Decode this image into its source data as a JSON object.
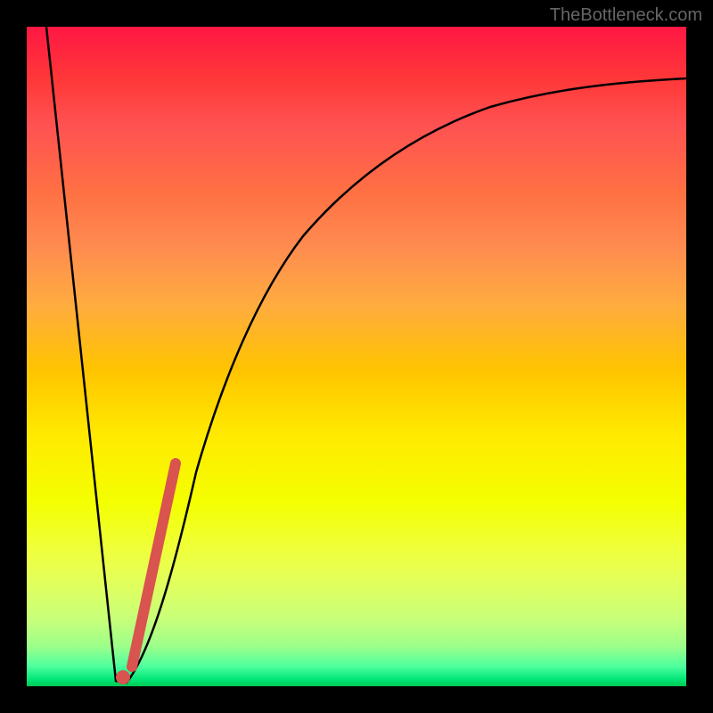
{
  "watermark": "TheBottleneck.com",
  "colors": {
    "overlay": "#d9534f",
    "curve": "#000000",
    "frame": "#000000"
  },
  "chart_data": {
    "type": "line",
    "title": "",
    "xlabel": "",
    "ylabel": "",
    "xlim": [
      0,
      100
    ],
    "ylim": [
      0,
      100
    ],
    "grid": false,
    "legend": false,
    "description": "Bottleneck curve: sharp descent from top-left to a minimum, then asymptotic rise toward top-right. Background heat gradient green(low)→red(high) indicates bottleneck severity.",
    "series": [
      {
        "name": "bottleneck-curve",
        "x": [
          3,
          6,
          9,
          12,
          13.5,
          15,
          18,
          22,
          26,
          30,
          36,
          44,
          54,
          66,
          80,
          92,
          100
        ],
        "y": [
          100,
          75,
          50,
          25,
          5,
          0,
          14,
          33,
          48,
          58,
          68,
          76,
          82,
          86,
          89,
          91,
          92
        ]
      }
    ],
    "overlay": {
      "segment": {
        "x": [
          15.5,
          22
        ],
        "y": [
          2,
          34
        ]
      },
      "marker": {
        "x": 14.5,
        "y": 0.8
      }
    },
    "heat_gradient_stops": [
      {
        "pos": 0,
        "color": "#ff1744"
      },
      {
        "pos": 50,
        "color": "#ffea00"
      },
      {
        "pos": 100,
        "color": "#00c853"
      }
    ]
  }
}
